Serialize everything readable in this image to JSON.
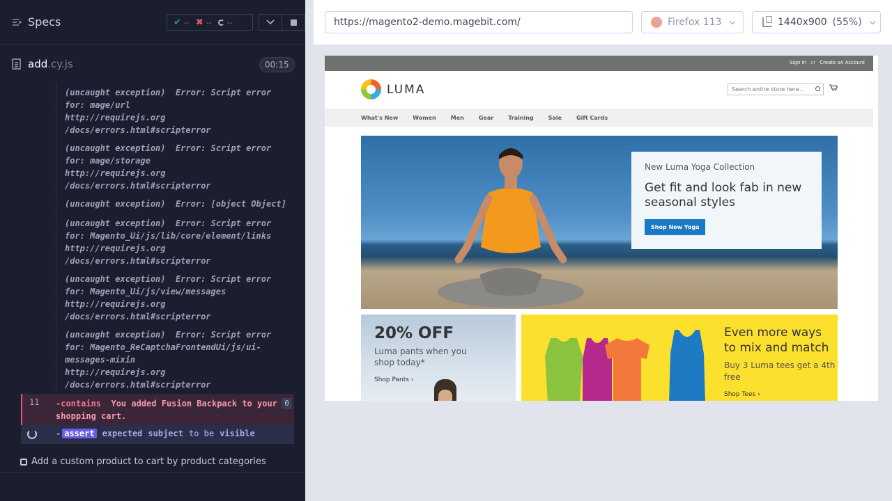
{
  "specs_bar": {
    "title": "Specs",
    "passed": "--",
    "failed": "--",
    "pending": "--"
  },
  "spec_file": {
    "name": "add",
    "ext": ".cy.js",
    "duration": "00:15"
  },
  "command_log": {
    "errors": [
      "(uncaught exception)  Error: Script error\nfor: mage/url\nhttp://requirejs.org\n/docs/errors.html#scripterror",
      "(uncaught exception)  Error: Script error\nfor: mage/storage\nhttp://requirejs.org\n/docs/errors.html#scripterror",
      "(uncaught exception)  Error: [object Object]",
      "(uncaught exception)  Error: Script error\nfor: Magento_Ui/js/lib/core/element/links\nhttp://requirejs.org\n/docs/errors.html#scripterror",
      "(uncaught exception)  Error: Script error\nfor: Magento_Ui/js/view/messages\nhttp://requirejs.org\n/docs/errors.html#scripterror",
      "(uncaught exception)  Error: Script error\nfor: Magento_ReCaptchaFrontendUi/js/ui-\nmessages-mixin\nhttp://requirejs.org\n/docs/errors.html#scripterror"
    ],
    "failed_command": {
      "number": "11",
      "name": "-contains",
      "text": "You added Fusion Backpack to your shopping cart.",
      "badge": "0"
    },
    "pending_command": {
      "prefix": "-",
      "tag": "assert",
      "w1": "expected",
      "w2": "subject",
      "w3": "to be",
      "w4": "visible"
    }
  },
  "test": {
    "title": "Add a custom product to cart by product categories"
  },
  "aut_header": {
    "url": "https://magento2-demo.magebit.com/",
    "browser": "Firefox 113",
    "viewport": "1440x900",
    "scale": "(55%)"
  },
  "luma": {
    "sign_in": "Sign In",
    "or": "or",
    "create_account": "Create an Account",
    "logo_text": "LUMA",
    "search_placeholder": "Search entire store here...",
    "nav": [
      "What's New",
      "Women",
      "Men",
      "Gear",
      "Training",
      "Sale",
      "Gift Cards"
    ],
    "hero": {
      "kicker": "New Luma Yoga Collection",
      "title": "Get fit and look fab in new seasonal styles",
      "button": "Shop New Yoga"
    },
    "promo1": {
      "headline": "20% OFF",
      "desc": "Luma pants when you shop today*",
      "link": "Shop Pants ›"
    },
    "promo2": {
      "title": "Even more ways to mix and match",
      "desc": "Buy 3 Luma tees get a 4th free",
      "link": "Shop Tees ›"
    }
  },
  "colors": {
    "pass": "#1fa971",
    "fail": "#e45770",
    "assert": "#6c5ce7",
    "luma_blue": "#1979c3",
    "promo_yellow": "#fce02e"
  }
}
